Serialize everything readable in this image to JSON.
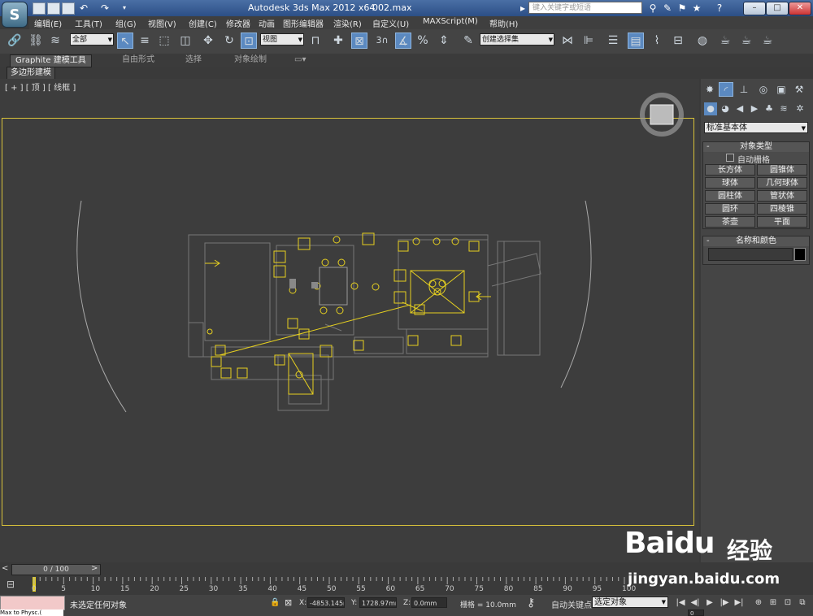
{
  "window": {
    "title": "Autodesk 3ds Max  2012 x64",
    "file": "002.max",
    "search_placeholder": "键入关键字或短语"
  },
  "menu": [
    "编辑(E)",
    "工具(T)",
    "组(G)",
    "视图(V)",
    "创建(C)",
    "修改器",
    "动画",
    "图形编辑器",
    "渲染(R)",
    "自定义(U)",
    "MAXScript(M)",
    "帮助(H)"
  ],
  "toolbar": {
    "filter": "全部",
    "coord_system": "视图",
    "snap_num": "3",
    "named_selection": "创建选择集"
  },
  "ribbon": {
    "tabs": [
      "Graphite 建模工具",
      "自由形式",
      "选择",
      "对象绘制"
    ],
    "sub": "多边形建模"
  },
  "viewport": {
    "label": "[ + ] [ 顶 ] [ 线框 ]"
  },
  "panel": {
    "category": "标准基本体",
    "object_type": {
      "title": "对象类型",
      "autogrid": "自动栅格",
      "buttons": [
        "长方体",
        "圆锥体",
        "球体",
        "几何球体",
        "圆柱体",
        "管状体",
        "圆环",
        "四棱锥",
        "茶壶",
        "平面"
      ]
    },
    "name_color": {
      "title": "名称和颜色"
    }
  },
  "timeline": {
    "slider": "0 / 100",
    "ticks": [
      "0",
      "5",
      "10",
      "15",
      "20",
      "25",
      "30",
      "35",
      "40",
      "45",
      "50",
      "55",
      "60",
      "65",
      "70",
      "75",
      "80",
      "85",
      "90",
      "95",
      "100"
    ]
  },
  "status": {
    "maxscript": "Max to Physc.(",
    "selection": "未选定任何对象",
    "x_label": "X:",
    "x": "-4853.145m",
    "y_label": "Y:",
    "y": "1728.97mm",
    "z_label": "Z:",
    "z": "0.0mm",
    "grid": "栅格 = 10.0mm",
    "autokey": "自动关键点",
    "selected": "选定对象",
    "frame": "0"
  },
  "watermark": {
    "logo": "Baidu",
    "cn": "经验",
    "url": "jingyan.baidu.com"
  },
  "colors": {
    "selection": "#e6d020",
    "background": "#3d3d3d"
  }
}
